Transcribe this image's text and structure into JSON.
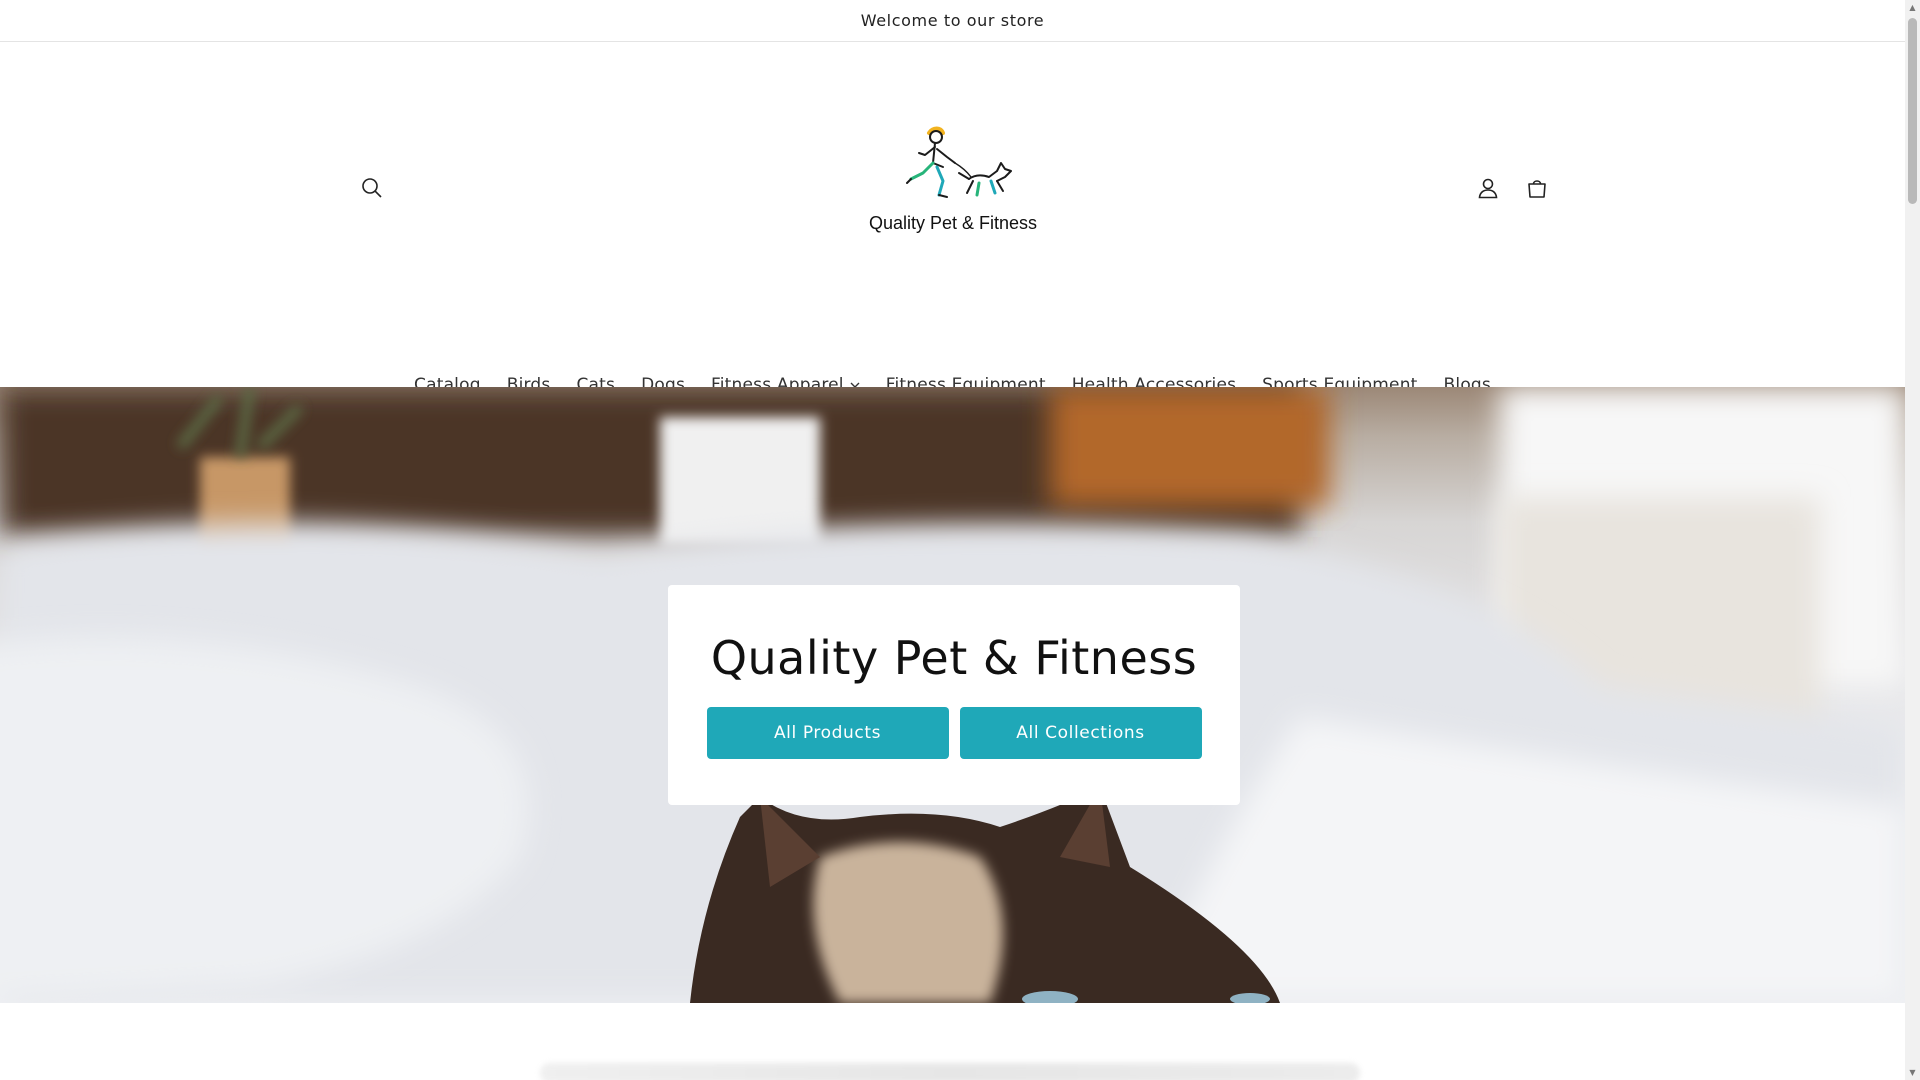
{
  "announcement": {
    "text": "Welcome to our store"
  },
  "header": {
    "logo_text": "Quality Pet & Fitness",
    "icons": {
      "search": "search-icon",
      "account": "account-icon",
      "cart": "cart-icon"
    }
  },
  "nav": {
    "items": [
      {
        "label": "Catalog"
      },
      {
        "label": "Birds"
      },
      {
        "label": "Cats"
      },
      {
        "label": "Dogs"
      },
      {
        "label": "Fitness Apparel"
      },
      {
        "label": "Fitness Equipment"
      },
      {
        "label": "Health Accessories"
      },
      {
        "label": "Sports Equipment"
      },
      {
        "label": "Blogs"
      }
    ]
  },
  "hero": {
    "title": "Quality Pet & Fitness",
    "primary_button": "All Products",
    "secondary_button": "All Collections"
  },
  "colors": {
    "accent": "#1fa8b8",
    "text": "#222222",
    "background": "#ffffff"
  }
}
